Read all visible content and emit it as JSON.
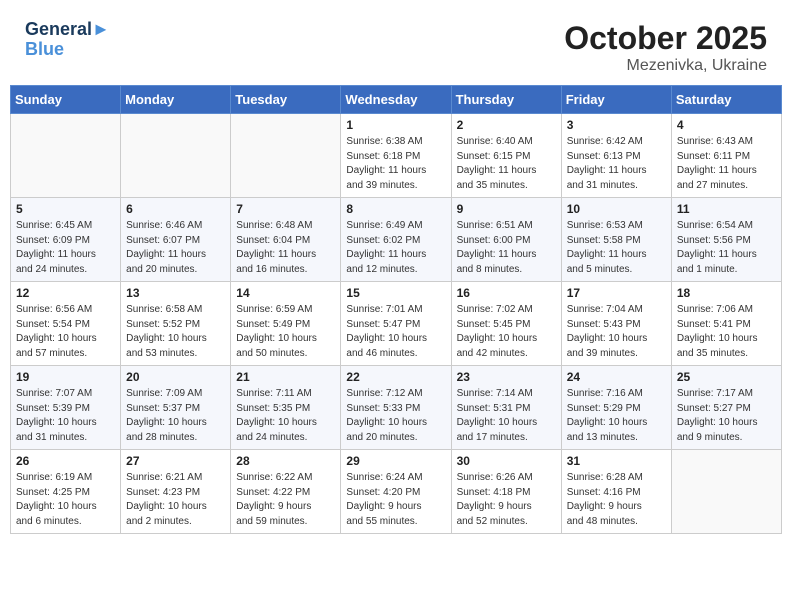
{
  "logo": {
    "line1": "General",
    "line2": "Blue"
  },
  "title": "October 2025",
  "location": "Mezenivka, Ukraine",
  "weekdays": [
    "Sunday",
    "Monday",
    "Tuesday",
    "Wednesday",
    "Thursday",
    "Friday",
    "Saturday"
  ],
  "weeks": [
    [
      {
        "day": "",
        "info": ""
      },
      {
        "day": "",
        "info": ""
      },
      {
        "day": "",
        "info": ""
      },
      {
        "day": "1",
        "info": "Sunrise: 6:38 AM\nSunset: 6:18 PM\nDaylight: 11 hours\nand 39 minutes."
      },
      {
        "day": "2",
        "info": "Sunrise: 6:40 AM\nSunset: 6:15 PM\nDaylight: 11 hours\nand 35 minutes."
      },
      {
        "day": "3",
        "info": "Sunrise: 6:42 AM\nSunset: 6:13 PM\nDaylight: 11 hours\nand 31 minutes."
      },
      {
        "day": "4",
        "info": "Sunrise: 6:43 AM\nSunset: 6:11 PM\nDaylight: 11 hours\nand 27 minutes."
      }
    ],
    [
      {
        "day": "5",
        "info": "Sunrise: 6:45 AM\nSunset: 6:09 PM\nDaylight: 11 hours\nand 24 minutes."
      },
      {
        "day": "6",
        "info": "Sunrise: 6:46 AM\nSunset: 6:07 PM\nDaylight: 11 hours\nand 20 minutes."
      },
      {
        "day": "7",
        "info": "Sunrise: 6:48 AM\nSunset: 6:04 PM\nDaylight: 11 hours\nand 16 minutes."
      },
      {
        "day": "8",
        "info": "Sunrise: 6:49 AM\nSunset: 6:02 PM\nDaylight: 11 hours\nand 12 minutes."
      },
      {
        "day": "9",
        "info": "Sunrise: 6:51 AM\nSunset: 6:00 PM\nDaylight: 11 hours\nand 8 minutes."
      },
      {
        "day": "10",
        "info": "Sunrise: 6:53 AM\nSunset: 5:58 PM\nDaylight: 11 hours\nand 5 minutes."
      },
      {
        "day": "11",
        "info": "Sunrise: 6:54 AM\nSunset: 5:56 PM\nDaylight: 11 hours\nand 1 minute."
      }
    ],
    [
      {
        "day": "12",
        "info": "Sunrise: 6:56 AM\nSunset: 5:54 PM\nDaylight: 10 hours\nand 57 minutes."
      },
      {
        "day": "13",
        "info": "Sunrise: 6:58 AM\nSunset: 5:52 PM\nDaylight: 10 hours\nand 53 minutes."
      },
      {
        "day": "14",
        "info": "Sunrise: 6:59 AM\nSunset: 5:49 PM\nDaylight: 10 hours\nand 50 minutes."
      },
      {
        "day": "15",
        "info": "Sunrise: 7:01 AM\nSunset: 5:47 PM\nDaylight: 10 hours\nand 46 minutes."
      },
      {
        "day": "16",
        "info": "Sunrise: 7:02 AM\nSunset: 5:45 PM\nDaylight: 10 hours\nand 42 minutes."
      },
      {
        "day": "17",
        "info": "Sunrise: 7:04 AM\nSunset: 5:43 PM\nDaylight: 10 hours\nand 39 minutes."
      },
      {
        "day": "18",
        "info": "Sunrise: 7:06 AM\nSunset: 5:41 PM\nDaylight: 10 hours\nand 35 minutes."
      }
    ],
    [
      {
        "day": "19",
        "info": "Sunrise: 7:07 AM\nSunset: 5:39 PM\nDaylight: 10 hours\nand 31 minutes."
      },
      {
        "day": "20",
        "info": "Sunrise: 7:09 AM\nSunset: 5:37 PM\nDaylight: 10 hours\nand 28 minutes."
      },
      {
        "day": "21",
        "info": "Sunrise: 7:11 AM\nSunset: 5:35 PM\nDaylight: 10 hours\nand 24 minutes."
      },
      {
        "day": "22",
        "info": "Sunrise: 7:12 AM\nSunset: 5:33 PM\nDaylight: 10 hours\nand 20 minutes."
      },
      {
        "day": "23",
        "info": "Sunrise: 7:14 AM\nSunset: 5:31 PM\nDaylight: 10 hours\nand 17 minutes."
      },
      {
        "day": "24",
        "info": "Sunrise: 7:16 AM\nSunset: 5:29 PM\nDaylight: 10 hours\nand 13 minutes."
      },
      {
        "day": "25",
        "info": "Sunrise: 7:17 AM\nSunset: 5:27 PM\nDaylight: 10 hours\nand 9 minutes."
      }
    ],
    [
      {
        "day": "26",
        "info": "Sunrise: 6:19 AM\nSunset: 4:25 PM\nDaylight: 10 hours\nand 6 minutes."
      },
      {
        "day": "27",
        "info": "Sunrise: 6:21 AM\nSunset: 4:23 PM\nDaylight: 10 hours\nand 2 minutes."
      },
      {
        "day": "28",
        "info": "Sunrise: 6:22 AM\nSunset: 4:22 PM\nDaylight: 9 hours\nand 59 minutes."
      },
      {
        "day": "29",
        "info": "Sunrise: 6:24 AM\nSunset: 4:20 PM\nDaylight: 9 hours\nand 55 minutes."
      },
      {
        "day": "30",
        "info": "Sunrise: 6:26 AM\nSunset: 4:18 PM\nDaylight: 9 hours\nand 52 minutes."
      },
      {
        "day": "31",
        "info": "Sunrise: 6:28 AM\nSunset: 4:16 PM\nDaylight: 9 hours\nand 48 minutes."
      },
      {
        "day": "",
        "info": ""
      }
    ]
  ]
}
